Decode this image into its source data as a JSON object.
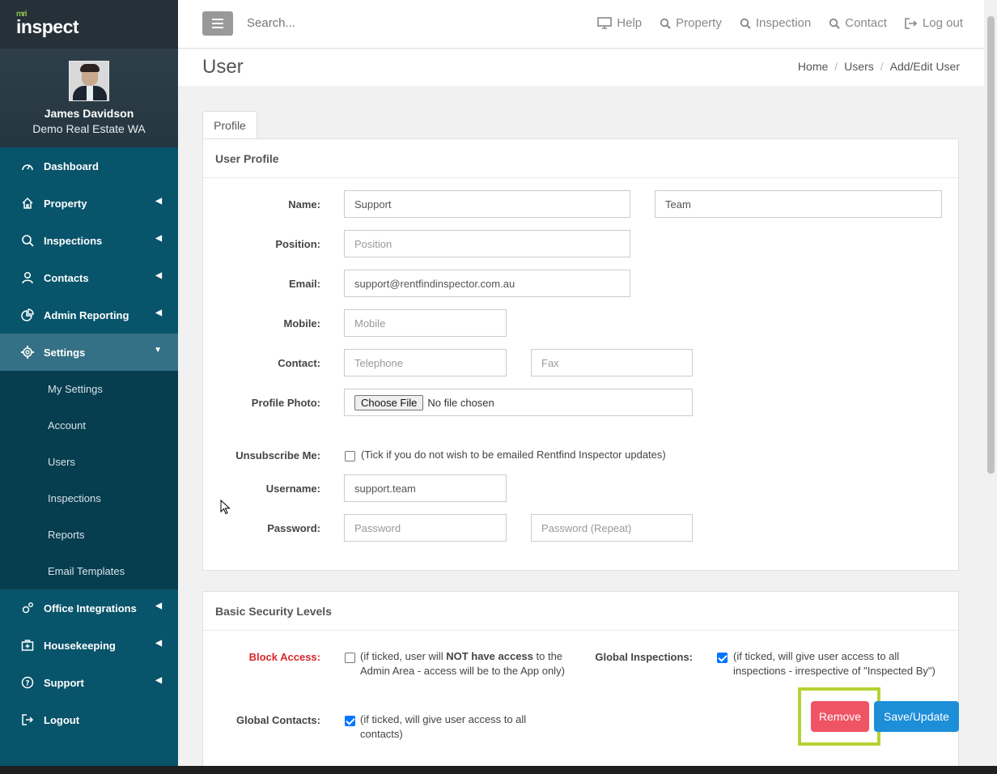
{
  "app": {
    "brand_small": "mri",
    "brand": "inspect"
  },
  "user": {
    "name": "James Davidson",
    "org": "Demo Real Estate WA"
  },
  "sidebar": {
    "items": [
      {
        "label": "Dashboard",
        "icon": "gauge-icon"
      },
      {
        "label": "Property",
        "icon": "home-icon"
      },
      {
        "label": "Inspections",
        "icon": "search-icon"
      },
      {
        "label": "Contacts",
        "icon": "person-icon"
      },
      {
        "label": "Admin Reporting",
        "icon": "pie-chart-icon"
      },
      {
        "label": "Settings",
        "icon": "gear-icon"
      }
    ],
    "sub_items": [
      "My Settings",
      "Account",
      "Users",
      "Inspections",
      "Reports",
      "Email Templates"
    ],
    "items_after": [
      {
        "label": "Office Integrations",
        "icon": "cogs-icon"
      },
      {
        "label": "Housekeeping",
        "icon": "medkit-icon"
      },
      {
        "label": "Support",
        "icon": "question-icon"
      },
      {
        "label": "Logout",
        "icon": "sign-out-icon"
      }
    ]
  },
  "topbar": {
    "search_placeholder": "Search...",
    "links": [
      "Help",
      "Property",
      "Inspection",
      "Contact",
      "Log out"
    ]
  },
  "page": {
    "title": "User",
    "breadcrumb": [
      "Home",
      "Users",
      "Add/Edit User"
    ],
    "tab": "Profile"
  },
  "profile": {
    "heading": "User Profile",
    "labels": {
      "name": "Name:",
      "position": "Position:",
      "email": "Email:",
      "mobile": "Mobile:",
      "contact": "Contact:",
      "photo": "Profile Photo:",
      "unsubscribe": "Unsubscribe Me:",
      "username": "Username:",
      "password": "Password:"
    },
    "first_name": "Support",
    "last_name": "Team",
    "position_ph": "Position",
    "email": "support@rentfindinspector.com.au",
    "mobile_ph": "Mobile",
    "telephone_ph": "Telephone",
    "fax_ph": "Fax",
    "choose_file": "Choose File",
    "no_file": "No file chosen",
    "unsubscribe_note": "(Tick if you do not wish to be emailed Rentfind Inspector updates)",
    "username": "support.team",
    "password_ph": "Password",
    "password_repeat_ph": "Password (Repeat)"
  },
  "security": {
    "heading": "Basic Security Levels",
    "block_access_label": "Block Access:",
    "block_access_note_a": "(if ticked, user will ",
    "block_access_note_b": "NOT have access",
    "block_access_note_c": " to the Admin Area - access will be to the App only)",
    "global_inspections_label": "Global Inspections:",
    "global_inspections_note": "(if ticked, will give user access to all inspections - irrespective of \"Inspected By\")",
    "global_contacts_label": "Global Contacts:",
    "global_contacts_note": "(if ticked, will give user access to all contacts)",
    "block_access_checked": false,
    "global_inspections_checked": true,
    "global_contacts_checked": true
  },
  "actions": {
    "remove": "Remove",
    "save": "Save/Update"
  },
  "colors": {
    "sidebar": "#07546b",
    "accent_red": "#ef5465",
    "accent_blue": "#1d8ed8",
    "highlight": "#b5d334",
    "block_label": "#d9262b"
  }
}
